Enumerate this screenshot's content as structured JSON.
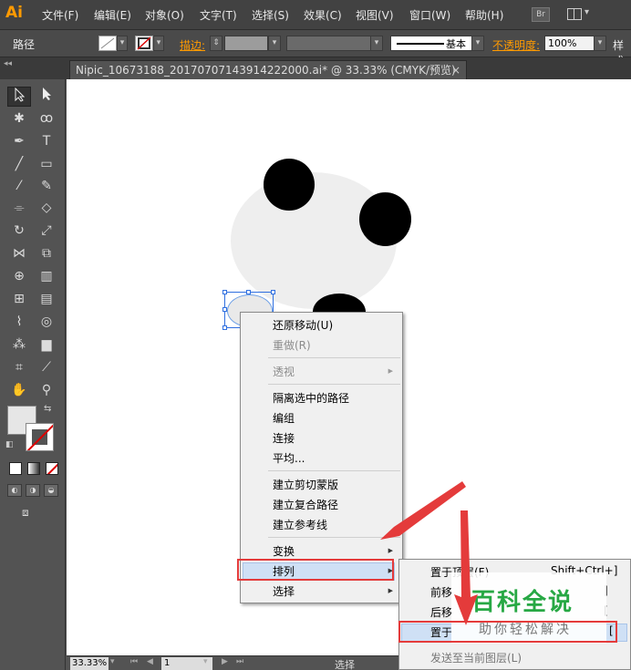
{
  "menubar": {
    "logo": "Ai",
    "items": [
      "文件(F)",
      "编辑(E)",
      "对象(O)",
      "文字(T)",
      "选择(S)",
      "效果(C)",
      "视图(V)",
      "窗口(W)",
      "帮助(H)"
    ],
    "bridge": "Br"
  },
  "controlbar": {
    "selection_type": "路径",
    "stroke_label": "描边:",
    "brush_label": "基本",
    "opacity_label": "不透明度:",
    "opacity_value": "100%",
    "style_label": "样式"
  },
  "document_tab": {
    "title": "Nipic_10673188_20170707143914222000.ai* @ 33.33% (CMYK/预览)",
    "close": "×"
  },
  "statusbar": {
    "zoom": "33.33%",
    "page": "1",
    "status": "选择"
  },
  "context_menu": {
    "items": [
      {
        "label": "还原移动(U)",
        "enabled": true
      },
      {
        "label": "重做(R)",
        "enabled": false
      },
      {
        "label": "透视",
        "enabled": false,
        "submenu": true
      },
      {
        "label": "隔离选中的路径",
        "enabled": true
      },
      {
        "label": "编组",
        "enabled": true
      },
      {
        "label": "连接",
        "enabled": true
      },
      {
        "label": "平均...",
        "enabled": true
      },
      {
        "label": "建立剪切蒙版",
        "enabled": true
      },
      {
        "label": "建立复合路径",
        "enabled": true
      },
      {
        "label": "建立参考线",
        "enabled": true
      },
      {
        "label": "变换",
        "enabled": true,
        "submenu": true
      },
      {
        "label": "排列",
        "enabled": true,
        "submenu": true,
        "highlighted": true
      },
      {
        "label": "选择",
        "enabled": true,
        "submenu": true
      }
    ]
  },
  "submenu": {
    "items": [
      {
        "label": "置于顶层(F)",
        "shortcut": "Shift+Ctrl+]"
      },
      {
        "label": "前移",
        "shortcut": "]"
      },
      {
        "label": "后移",
        "shortcut": "["
      },
      {
        "label": "置于",
        "shortcut": "[",
        "highlighted": true
      },
      {
        "label": "发送至当前图层(L)",
        "shortcut": "",
        "enabled": false
      }
    ]
  },
  "watermark": {
    "title": "百科全说",
    "subtitle": "助你轻松解决"
  },
  "colors": {
    "accent": "#ff9a00",
    "annotation": "#e43b3b",
    "watermark": "#27a844"
  }
}
